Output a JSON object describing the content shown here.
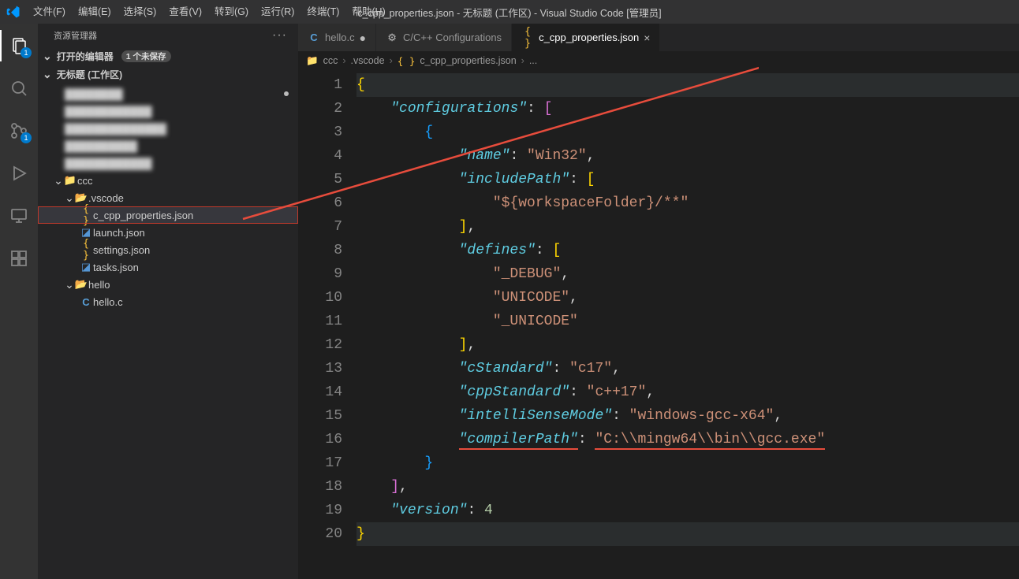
{
  "menubar": {
    "items": [
      "文件(F)",
      "编辑(E)",
      "选择(S)",
      "查看(V)",
      "转到(G)",
      "运行(R)",
      "终端(T)",
      "帮助(H)"
    ],
    "window_title": "c_cpp_properties.json - 无标题 (工作区) - Visual Studio Code [管理员]"
  },
  "activity": {
    "badge1": "1",
    "badge2": "1"
  },
  "sidebar": {
    "title": "资源管理器",
    "open_editors": "打开的编辑器",
    "open_editors_badge": "1 个未保存",
    "workspace": "无标题 (工作区)",
    "blur_items": [
      "████████",
      "████████████",
      "██████████████",
      "██████████",
      "████████████"
    ],
    "tree": {
      "ccc": "ccc",
      "vscode": ".vscode",
      "cpp_props": "c_cpp_properties.json",
      "launch": "launch.json",
      "settings": "settings.json",
      "tasks": "tasks.json",
      "hello_folder": "hello",
      "hello_c": "hello.c"
    }
  },
  "tabs": {
    "helloc": "hello.c",
    "cppconfig": "C/C++ Configurations",
    "cppprops": "c_cpp_properties.json"
  },
  "breadcrumbs": [
    "ccc",
    ".vscode",
    "c_cpp_properties.json",
    "..."
  ],
  "code": {
    "line1": "{",
    "k_configurations": "\"configurations\"",
    "k_name": "\"name\"",
    "v_name": "\"Win32\"",
    "k_includePath": "\"includePath\"",
    "v_include0": "\"${workspaceFolder}/**\"",
    "k_defines": "\"defines\"",
    "v_def0": "\"_DEBUG\"",
    "v_def1": "\"UNICODE\"",
    "v_def2": "\"_UNICODE\"",
    "k_cStandard": "\"cStandard\"",
    "v_cStandard": "\"c17\"",
    "k_cppStandard": "\"cppStandard\"",
    "v_cppStandard": "\"c++17\"",
    "k_intelli": "\"intelliSenseMode\"",
    "v_intelli": "\"windows-gcc-x64\"",
    "k_compilerPath": "\"compilerPath\"",
    "v_compilerPath": "\"C:\\\\mingw64\\\\bin\\\\gcc.exe\"",
    "k_version": "\"version\"",
    "v_version": "4"
  }
}
